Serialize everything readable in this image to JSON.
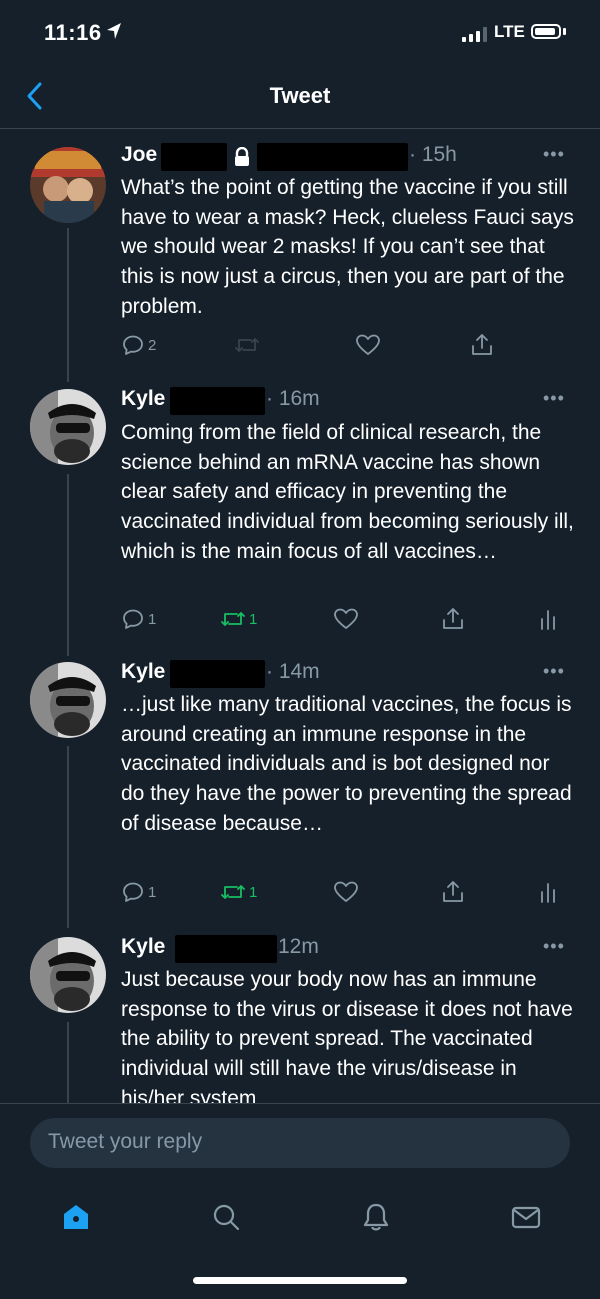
{
  "status_bar": {
    "time": "11:16",
    "network": "LTE"
  },
  "header": {
    "title": "Tweet",
    "back_icon": "chevron-left-icon"
  },
  "tweets": [
    {
      "name": "Joe",
      "locked": true,
      "time": "· 15h",
      "text": "What’s the point of getting the vaccine if you still have to wear a mask? Heck, clueless Fauci says we should wear 2 masks! If you can’t see that this is now just a circus, then you are part of the problem.",
      "reply_count": "2",
      "retweet_count": "",
      "retweeted": false
    },
    {
      "name": "Kyle",
      "time": "· 16m",
      "text": "Coming from the field of clinical research, the science behind an mRNA vaccine has shown clear safety and efficacy in preventing the vaccinated individual from becoming seriously ill, which is the main focus of all vaccines…",
      "reply_count": "1",
      "retweet_count": "1",
      "retweeted": true
    },
    {
      "name": "Kyle",
      "time": "· 14m",
      "text": "…just like many traditional vaccines, the focus is around creating an immune response in the vaccinated individuals and is bot designed nor do they have the power to preventing the spread of disease because…",
      "reply_count": "1",
      "retweet_count": "1",
      "retweeted": true
    },
    {
      "name": "Kyle",
      "time": "12m",
      "text": "Just because your body now has an immune response to the virus or disease it does not have the ability to prevent spread. The vaccinated individual will still have the virus/disease in his/her system"
    }
  ],
  "reply": {
    "placeholder": "Tweet your reply"
  },
  "tabs": [
    "home-icon",
    "search-icon",
    "notifications-icon",
    "messages-icon"
  ],
  "colors": {
    "background": "#15202b",
    "accent": "#1da1f2",
    "muted": "#8899a6",
    "retweet": "#17bf63",
    "divider": "#38444d"
  }
}
